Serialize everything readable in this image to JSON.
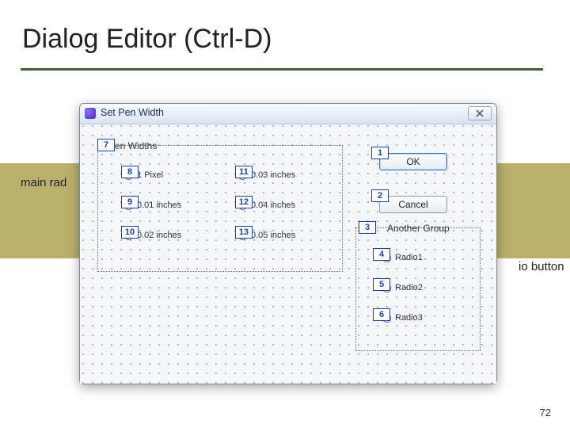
{
  "slide": {
    "heading": "Dialog Editor (Ctrl-D)",
    "left_note": "main rad",
    "right_note": "io button",
    "page_number": "72"
  },
  "window": {
    "title": "Set Pen Width"
  },
  "groups": {
    "pen_widths_label": "Pen Widths",
    "another_group_label": "Another Group"
  },
  "buttons": {
    "ok": "OK",
    "cancel": "Cancel"
  },
  "pen_radios": {
    "r8": "1 Pixel",
    "r9": "0.01 inches",
    "r10": "0.02 inches",
    "r11": "0.03 inches",
    "r12": "0.04 inches",
    "r13": "0.05 inches"
  },
  "another_radios": {
    "r4": "Radio1",
    "r5": "Radio2",
    "r6": "Radio3"
  },
  "markers": {
    "m1": "1",
    "m2": "2",
    "m3": "3",
    "m4": "4",
    "m5": "5",
    "m6": "6",
    "m7": "7",
    "m8": "8",
    "m9": "9",
    "m10": "10",
    "m11": "11",
    "m12": "12",
    "m13": "13"
  }
}
